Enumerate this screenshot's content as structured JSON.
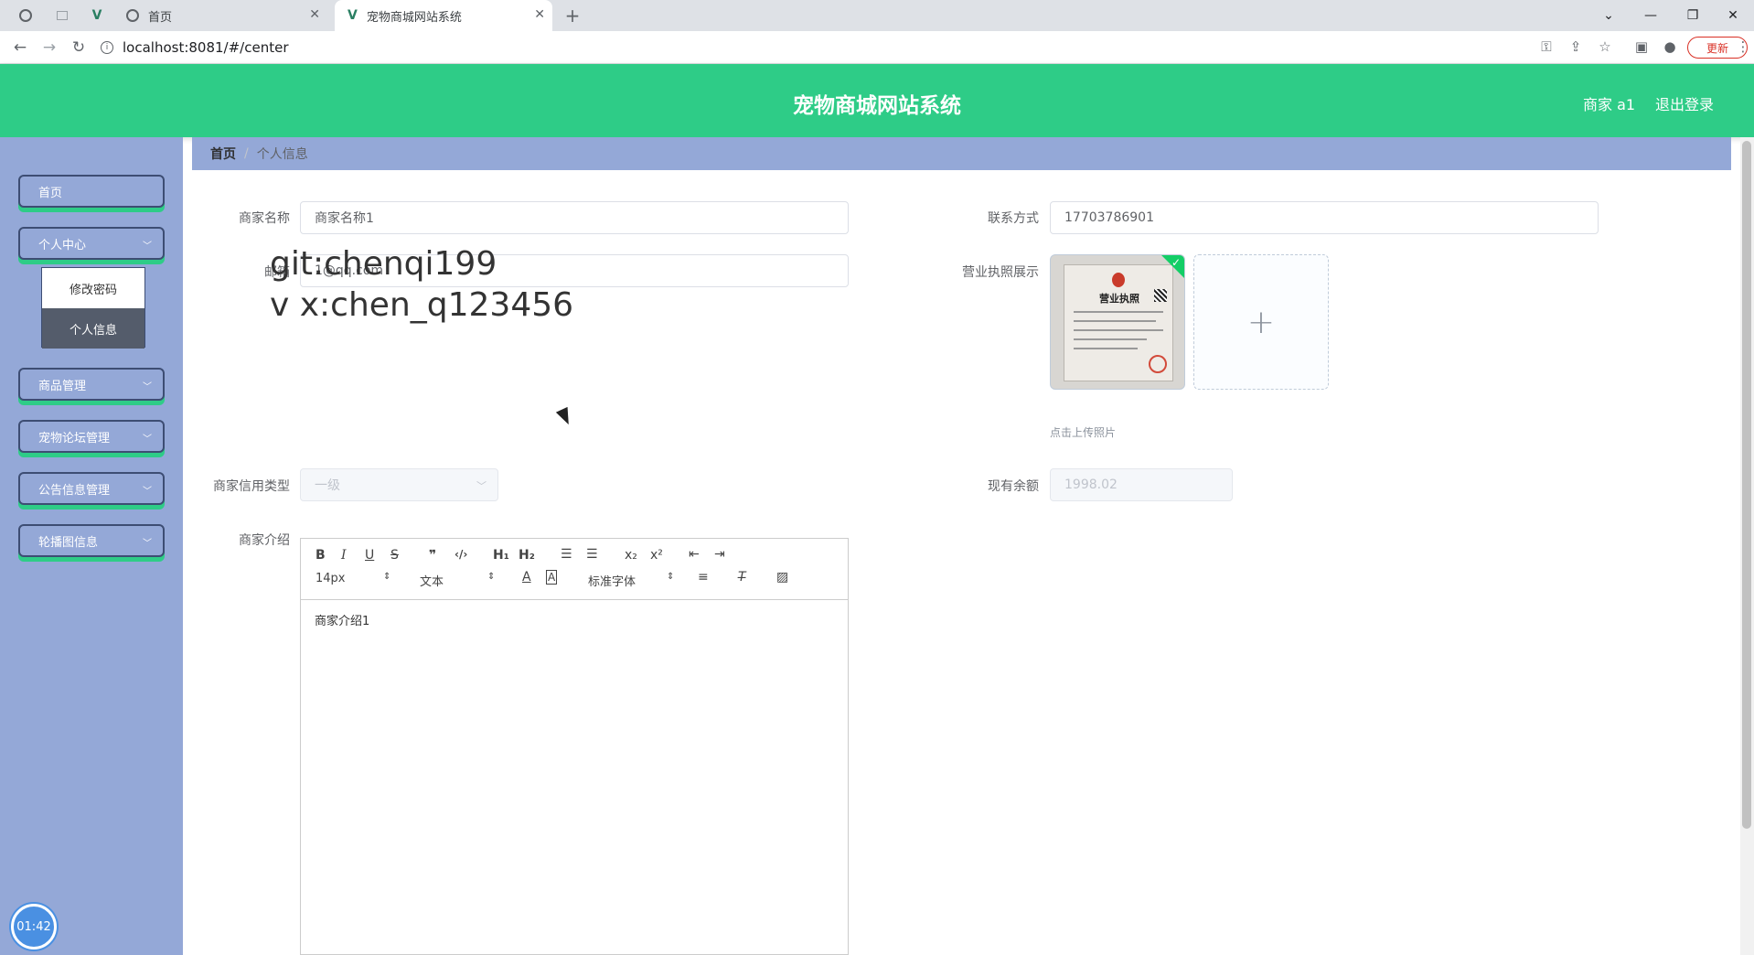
{
  "browser": {
    "tabs": [
      {
        "title": "首页"
      },
      {
        "title": "宠物商城网站系统"
      }
    ],
    "new_tab": "+",
    "url": "localhost:8081/#/center",
    "update_label": "更新"
  },
  "header": {
    "title": "宠物商城网站系统",
    "user": "商家 a1",
    "logout": "退出登录"
  },
  "sidebar": {
    "items": [
      {
        "label": "首页"
      },
      {
        "label": "个人中心"
      },
      {
        "label": "商品管理"
      },
      {
        "label": "宠物论坛管理"
      },
      {
        "label": "公告信息管理"
      },
      {
        "label": "轮播图信息"
      }
    ],
    "submenu": [
      {
        "label": "修改密码"
      },
      {
        "label": "个人信息"
      }
    ]
  },
  "breadcrumb": {
    "home": "首页",
    "separator": "/",
    "current": "个人信息"
  },
  "form": {
    "name_label": "商家名称",
    "name_value": "商家名称1",
    "contact_label": "联系方式",
    "contact_value": "17703786901",
    "email_label": "邮箱",
    "email_value": "1@qq.com",
    "license_label": "营业执照展示",
    "license_title": "营业执照",
    "upload_tip": "点击上传照片",
    "credit_label": "商家信用类型",
    "credit_value": "一级",
    "balance_label": "现有余额",
    "balance_value": "1998.02",
    "intro_label": "商家介绍",
    "intro_value": "商家介绍1"
  },
  "editor": {
    "font_size": "14px",
    "block_type": "文本",
    "font_family": "标准字体"
  },
  "watermark": {
    "line1": "git:chenqi199",
    "line2": "v x:chen_q123456"
  },
  "timer": "01:42"
}
